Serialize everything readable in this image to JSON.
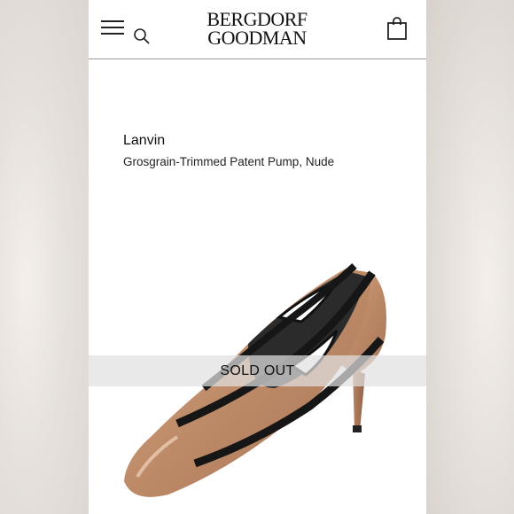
{
  "header": {
    "logo_line1": "BERGDORF",
    "logo_line2": "GOODMAN",
    "menu_icon": "hamburger-menu-icon",
    "search_icon": "search-icon",
    "bag_icon": "shopping-bag-icon"
  },
  "product": {
    "brand": "Lanvin",
    "name": "Grosgrain-Trimmed Patent Pump, Nude",
    "status": "SOLD OUT"
  },
  "colors": {
    "shoe_nude": "#c08f6d",
    "trim_black": "#1a1a1a",
    "header_rule": "#9a9a9a"
  }
}
